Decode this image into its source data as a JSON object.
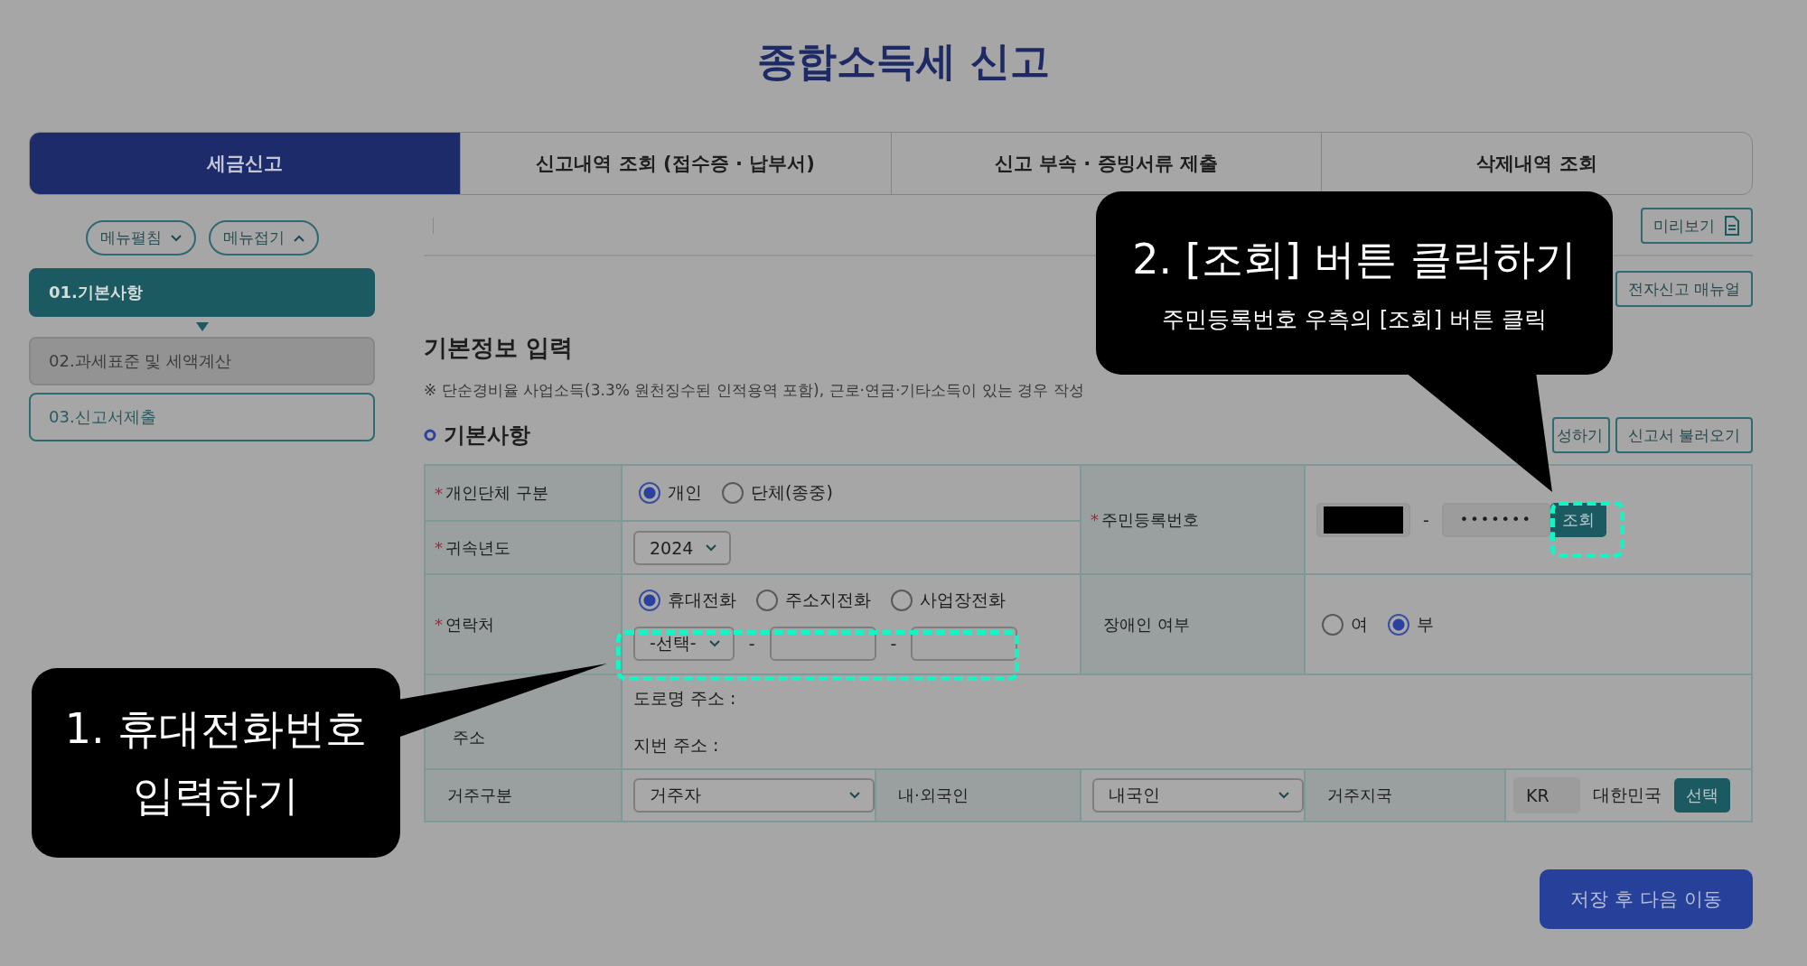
{
  "page_title": "종합소득세 신고",
  "tabs": [
    {
      "label": "세금신고",
      "selected": true
    },
    {
      "label": "신고내역 조회 (접수증 · 납부서)",
      "selected": false
    },
    {
      "label": "신고 부속 · 증빙서류 제출",
      "selected": false
    },
    {
      "label": "삭제내역 조회",
      "selected": false
    }
  ],
  "sidebar": {
    "menu_buttons": [
      {
        "label": "메뉴펼침",
        "kind": "expand"
      },
      {
        "label": "메뉴접기",
        "kind": "collapse"
      }
    ],
    "steps": [
      {
        "label": "01.기본사항",
        "selected": true,
        "disabled": false
      },
      {
        "label": "02.과세표준 및 세액계산",
        "selected": false,
        "disabled": true
      },
      {
        "label": "03.신고서제출",
        "selected": false,
        "disabled": false
      }
    ]
  },
  "toolbar": {
    "preview_button": "미리보기",
    "manual_button": "전자신고 매뉴얼"
  },
  "section": {
    "heading": "기본정보 입력",
    "note": "※ 단순경비율 사업소득(3.3% 원천징수된 인적용역 포함), 근로·연금·기타소득이 있는 경우 작성",
    "subheading": "기본사항",
    "buttons": [
      "성하기",
      "신고서 불러오기"
    ]
  },
  "form": {
    "entity_type": {
      "label": "개인단체 구분",
      "required_mark": "*",
      "options": [
        {
          "label": "개인",
          "selected": true
        },
        {
          "label": "단체(종중)",
          "selected": false
        }
      ]
    },
    "tax_year": {
      "label": "귀속년도",
      "required_mark": "*",
      "value": "2024"
    },
    "resident_number": {
      "label": "주민등록번호",
      "required_mark": "*",
      "first_part_redacted": true,
      "separator": "-",
      "second_part": "•••••••",
      "lookup_button": "조회"
    },
    "contact": {
      "label": "연락처",
      "required_mark": "*",
      "options": [
        {
          "label": "휴대전화",
          "selected": true
        },
        {
          "label": "주소지전화",
          "selected": false
        },
        {
          "label": "사업장전화",
          "selected": false
        }
      ],
      "area_code": "-선택-",
      "separators": [
        "-",
        "-"
      ]
    },
    "disability": {
      "label": "장애인 여부",
      "options": [
        {
          "label": "여",
          "selected": false
        },
        {
          "label": "부",
          "selected": true
        }
      ]
    },
    "address": {
      "label": "주소",
      "lines": [
        "도로명 주소 :",
        "지번 주소 :"
      ]
    },
    "residence": {
      "label": "거주구분",
      "value": "거주자"
    },
    "nationality": {
      "label": "내·외국인",
      "value": "내국인"
    },
    "country": {
      "label": "거주지국",
      "code": "KR",
      "name": "대한민국",
      "button": "선택"
    }
  },
  "save_button": "저장 후 다음 이동",
  "callouts": [
    {
      "kind": "phone",
      "lines": [
        "1. 휴대전화번호",
        "입력하기"
      ]
    },
    {
      "kind": "lookup",
      "lines": [
        "2. [조회] 버튼 클릭하기",
        "주민등록번호 우측의 [조회] 버튼 클릭"
      ]
    }
  ]
}
